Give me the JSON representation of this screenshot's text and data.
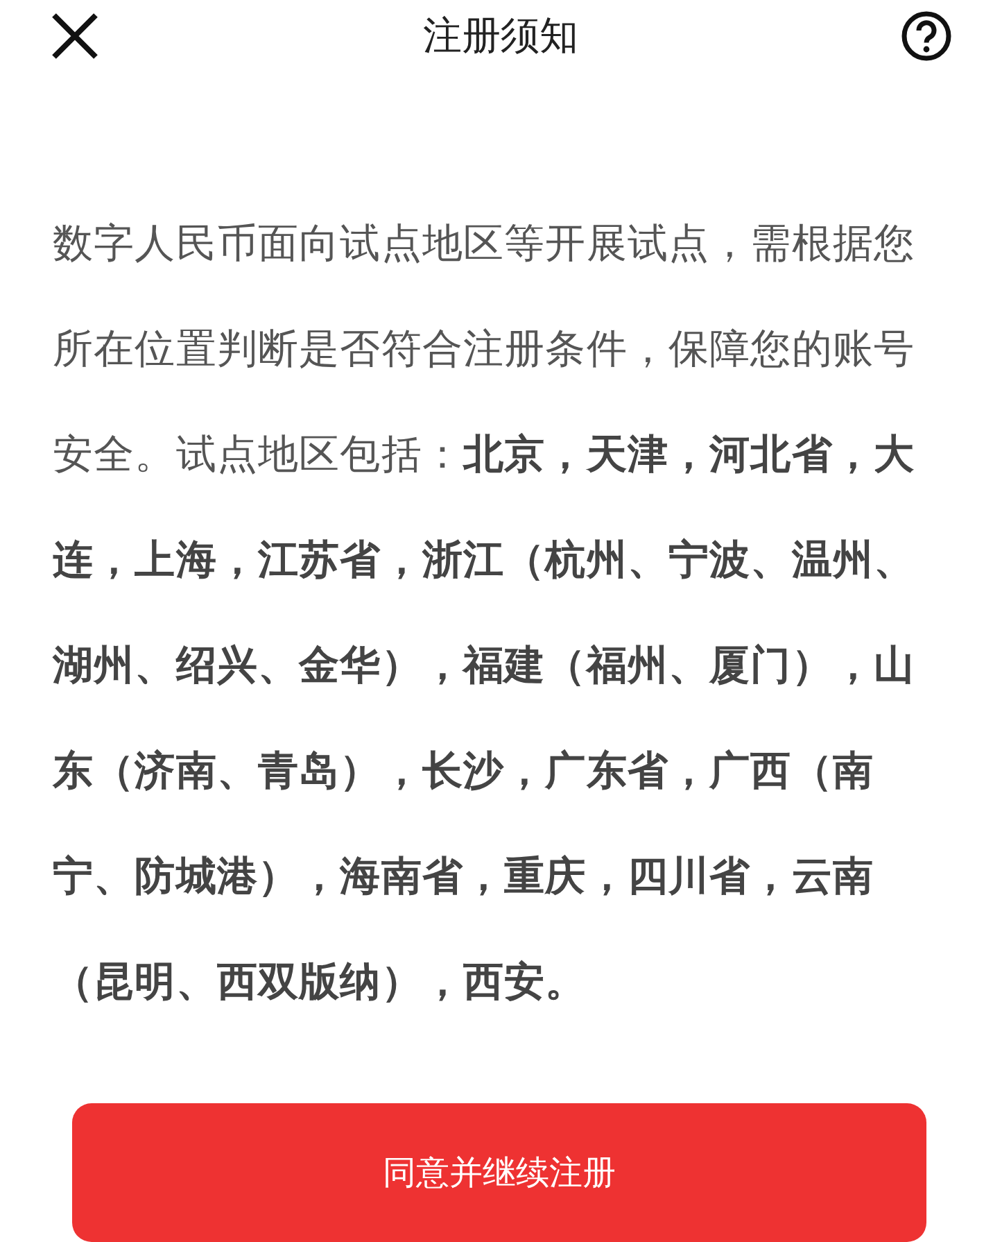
{
  "header": {
    "title": "注册须知"
  },
  "notice": {
    "text": "数字人民币面向试点地区等开展试点，需根据您所在位置判断是否符合注册条件，保障您的账号安全。试点地区包括：**北京，天津，河北省，大连，上海，江苏省，浙江（杭州、宁波、温州、湖州、绍兴、金华），福建（福州、厦门），山东（济南、青岛），长沙，广东省，广西（南宁、防城港），海南省，重庆，四川省，云南（昆明、西双版纳），西安。**"
  },
  "buttons": [
    {
      "label": "同意并继续注册"
    }
  ]
}
